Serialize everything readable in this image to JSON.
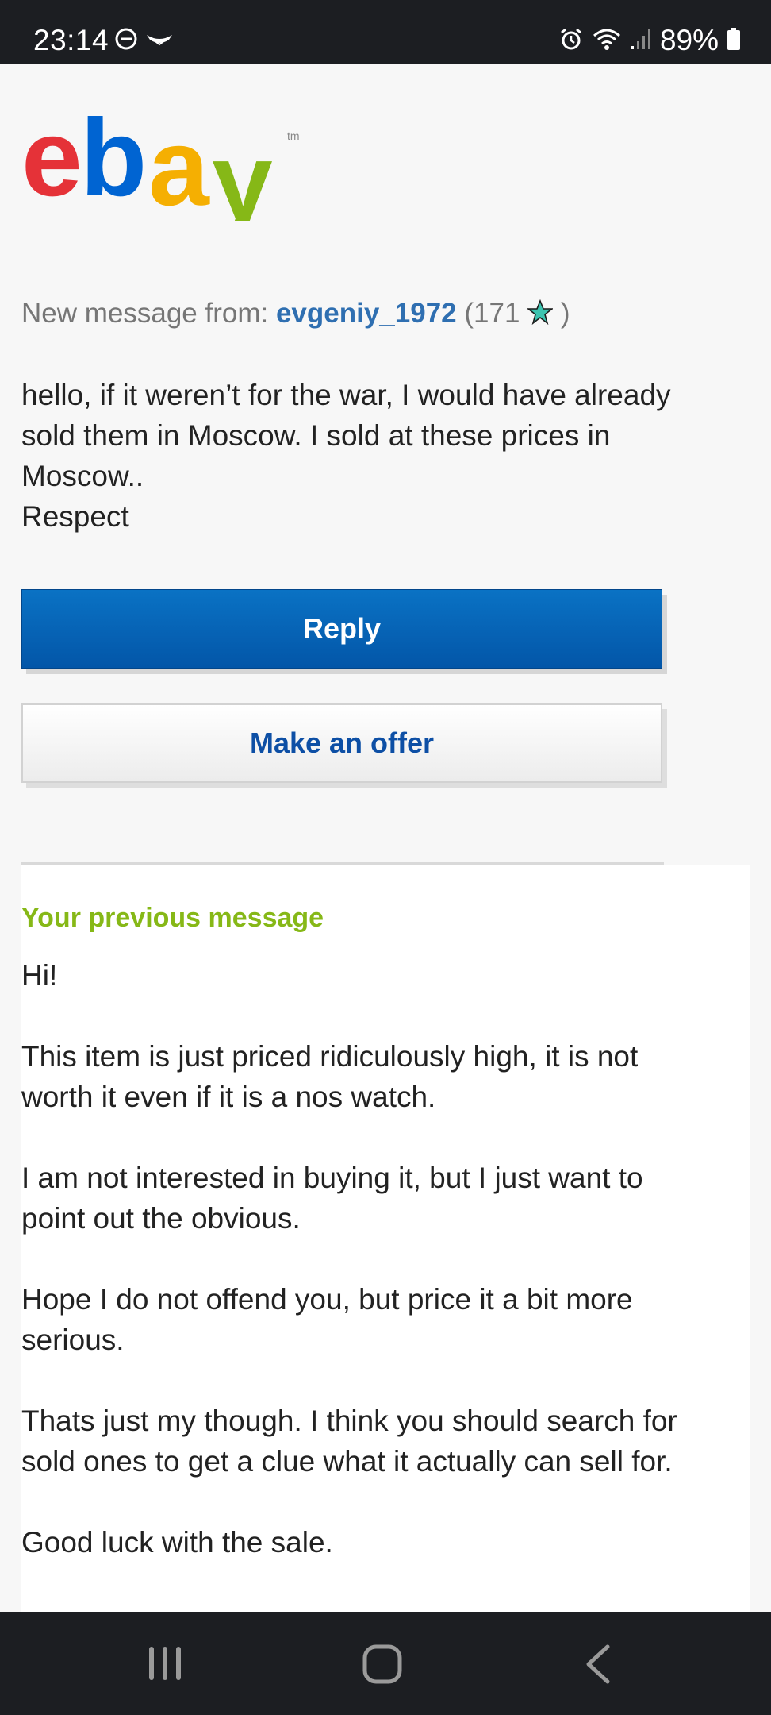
{
  "status_bar": {
    "time": "23:14",
    "battery": "89%",
    "icons": [
      "do-not-disturb-icon",
      "notification-icon",
      "alarm-icon",
      "wifi-icon",
      "signal-icon",
      "battery-icon"
    ]
  },
  "logo": {
    "letters": [
      "e",
      "b",
      "a",
      "y"
    ],
    "colors": [
      "#e53238",
      "#0064d2",
      "#f5af02",
      "#86b817"
    ],
    "tm": "tm"
  },
  "sender": {
    "prefix": "New message from:",
    "username": "evgeniy_1972",
    "feedback_open": "(171",
    "feedback_close": ")",
    "star_icon": "turquoise-star-icon"
  },
  "message": {
    "line1": "hello, if it weren’t for the war, I would have already sold them in Moscow. I sold at these prices in Moscow..",
    "line2": "Respect"
  },
  "buttons": {
    "reply": "Reply",
    "offer": "Make an offer"
  },
  "previous": {
    "heading": "Your previous message",
    "paragraphs": [
      "Hi!",
      "This item is just priced ridiculously high, it is not worth it even if it is a nos watch.",
      "I am not interested in buying it, but I just want to point out the obvious.",
      "Hope I do not offend you, but price it a bit more serious.",
      "Thats just my though. I think you should search for sold ones to get a clue what it actually can sell for.",
      "Good luck with the sale."
    ]
  },
  "colors": {
    "reply_button": "#0a72c4",
    "offer_text": "#0d4fa5",
    "heading_green": "#86b817",
    "sender_blue": "#2f6fb1"
  }
}
